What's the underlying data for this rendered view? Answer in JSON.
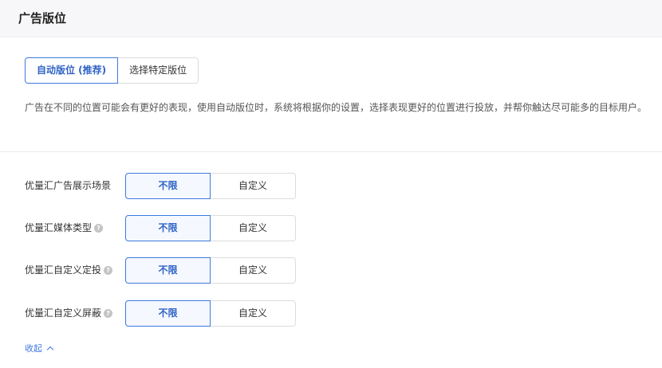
{
  "header": {
    "title": "广告版位"
  },
  "placement_mode": {
    "options": [
      "自动版位 (推荐)",
      "选择特定版位"
    ],
    "selected": "自动版位 (推荐)"
  },
  "description": "广告在不同的位置可能会有更好的表现，使用自动版位时，系统将根据你的设置，选择表现更好的位置进行投放，并帮你触达尽可能多的目标用户。",
  "settings": [
    {
      "label": "优量汇广告展示场景",
      "has_help": false,
      "options": [
        "不限",
        "自定义"
      ],
      "selected": "不限"
    },
    {
      "label": "优量汇媒体类型",
      "has_help": true,
      "options": [
        "不限",
        "自定义"
      ],
      "selected": "不限"
    },
    {
      "label": "优量汇自定义定投",
      "has_help": true,
      "options": [
        "不限",
        "自定义"
      ],
      "selected": "不限"
    },
    {
      "label": "优量汇自定义屏蔽",
      "has_help": true,
      "options": [
        "不限",
        "自定义"
      ],
      "selected": "不限"
    }
  ],
  "help_icon_glyph": "?",
  "collapse_label": "收起",
  "colors": {
    "accent": "#3f7ae0",
    "accent_text": "#2f63c7",
    "header_bg": "#f7f7f9"
  }
}
